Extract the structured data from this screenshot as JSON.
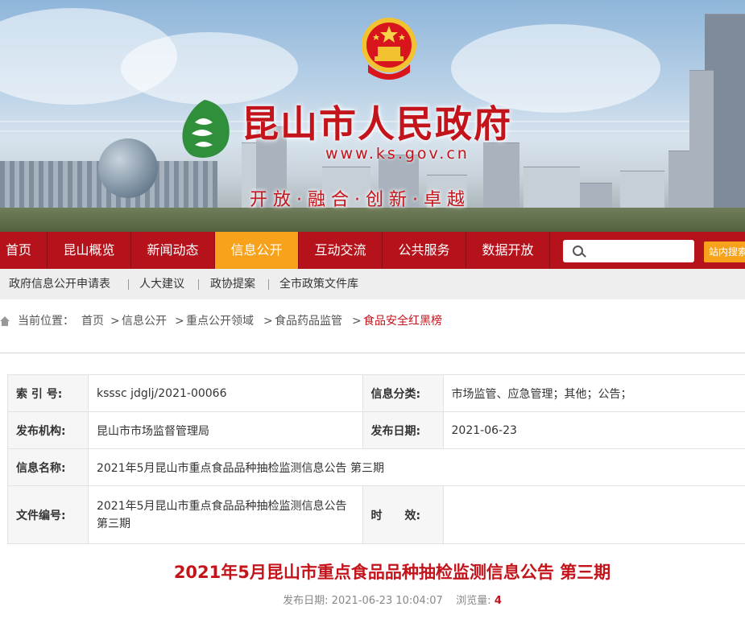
{
  "header": {
    "site_title": "昆山市人民政府",
    "site_url": "www.ks.gov.cn",
    "slogan": "开放·融合·创新·卓越"
  },
  "nav": {
    "items": [
      {
        "label": "首页"
      },
      {
        "label": "昆山概览"
      },
      {
        "label": "新闻动态"
      },
      {
        "label": "信息公开",
        "active": true
      },
      {
        "label": "互动交流"
      },
      {
        "label": "公共服务"
      },
      {
        "label": "数据开放"
      }
    ],
    "search_placeholder": "",
    "search_button": "站内搜索"
  },
  "subnav": {
    "items": [
      {
        "label": "政府信息公开申请表"
      },
      {
        "label": "人大建议"
      },
      {
        "label": "政协提案"
      },
      {
        "label": "全市政策文件库"
      }
    ]
  },
  "breadcrumb": {
    "prefix": "当前位置：",
    "items": [
      "首页",
      "信息公开",
      "重点公开领域",
      "食品药品监管",
      "食品安全红黑榜"
    ],
    "separator": ">"
  },
  "info_table": {
    "index_label": "索 引 号:",
    "index_value": "ksssc jdglj/2021-00066",
    "category_label": "信息分类:",
    "category_value": "市场监管、应急管理；其他；公告；",
    "publisher_label": "发布机构:",
    "publisher_value": "昆山市市场监督管理局",
    "date_label": "发布日期:",
    "date_value": "2021-06-23",
    "name_label": "信息名称:",
    "name_value": "2021年5月昆山市重点食品品种抽检监测信息公告 第三期",
    "doc_label": "文件编号:",
    "doc_value": "2021年5月昆山市重点食品品种抽检监测信息公告第三期",
    "validity_label": "时　　效:",
    "validity_value": ""
  },
  "article": {
    "title": "2021年5月昆山市重点食品品种抽检监测信息公告 第三期",
    "published_label": "发布日期:",
    "published_value": "2021-06-23 10:04:07",
    "views_label": "浏览量:",
    "views_value": "4"
  },
  "colors": {
    "brand_red": "#b5121b",
    "active_orange": "#f7a21a",
    "title_red": "#c4141b"
  }
}
